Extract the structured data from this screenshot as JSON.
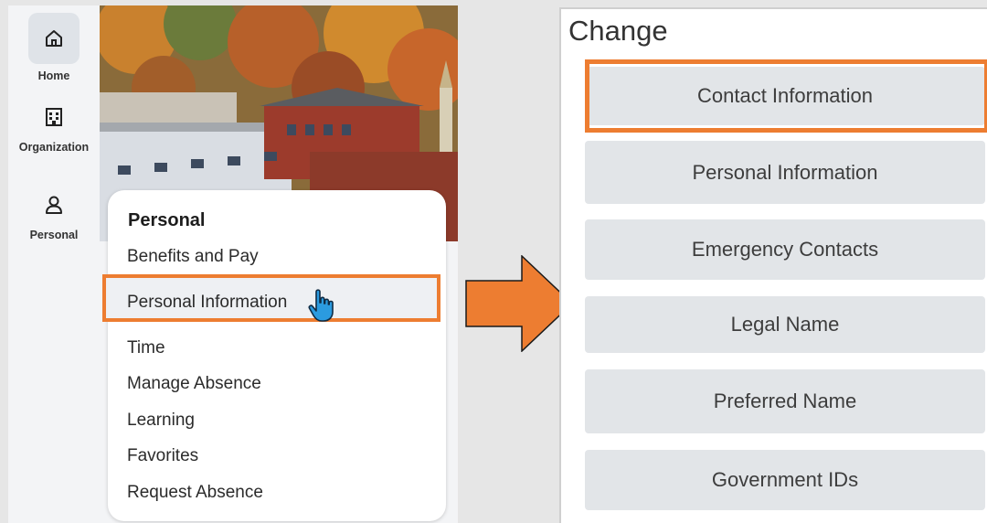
{
  "colors": {
    "accent_orange": "#ed7d31",
    "button_bg": "#e2e5e8",
    "sidebar_bg": "#f3f4f6",
    "cursor_blue": "#1e90d6"
  },
  "sidebar": {
    "items": [
      {
        "label": "Home",
        "icon": "home-icon"
      },
      {
        "label": "Organization",
        "icon": "organization-icon"
      },
      {
        "label": "Personal",
        "icon": "person-icon"
      }
    ]
  },
  "menu": {
    "title": "Personal",
    "items": [
      "Benefits and Pay",
      "Personal Information",
      "Time",
      "Manage Absence",
      "Learning",
      "Favorites",
      "Request Absence"
    ]
  },
  "change_panel": {
    "title": "Change",
    "buttons": [
      "Contact Information",
      "Personal Information",
      "Emergency Contacts",
      "Legal Name",
      "Preferred Name",
      "Government IDs"
    ]
  }
}
